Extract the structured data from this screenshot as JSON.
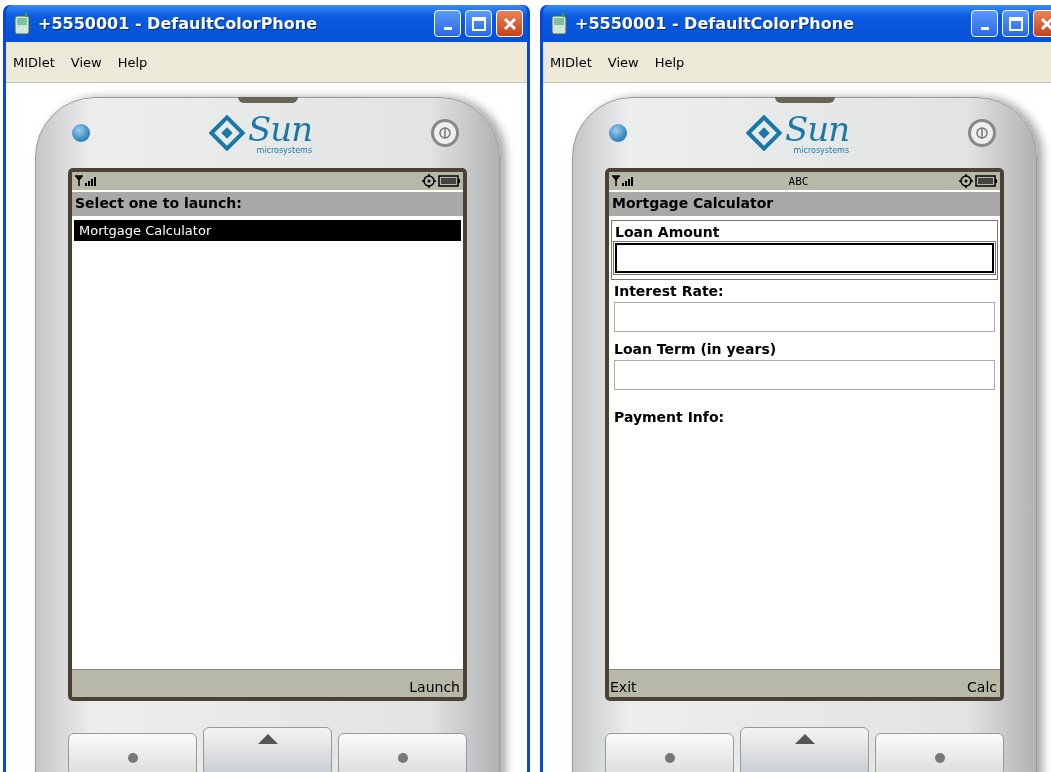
{
  "windows": [
    {
      "title": "+5550001 - DefaultColorPhone",
      "menu": [
        "MIDlet",
        "View",
        "Help"
      ],
      "brand": "Sun",
      "brand_sub": "microsystems",
      "screen": {
        "title": "Select one to launch:",
        "kind": "list",
        "items": [
          {
            "label": "Mortgage Calculator",
            "selected": true
          }
        ],
        "soft_keys": {
          "right": "Launch"
        }
      }
    },
    {
      "title": "+5550001 - DefaultColorPhone",
      "menu": [
        "MIDlet",
        "View",
        "Help"
      ],
      "brand": "Sun",
      "brand_sub": "microsystems",
      "screen": {
        "input_mode": "ABC",
        "title": "Mortgage Calculator",
        "kind": "form",
        "items": [
          {
            "kind": "text_field",
            "label": "Loan Amount",
            "focused": true
          },
          {
            "kind": "text_field",
            "label": "Interest Rate:",
            "focused": false
          },
          {
            "kind": "text_field",
            "label": "Loan Term (in years)",
            "focused": false
          },
          {
            "kind": "string",
            "label": "Payment Info:"
          }
        ],
        "soft_keys": {
          "left": "Exit",
          "right": "Calc"
        }
      }
    }
  ]
}
